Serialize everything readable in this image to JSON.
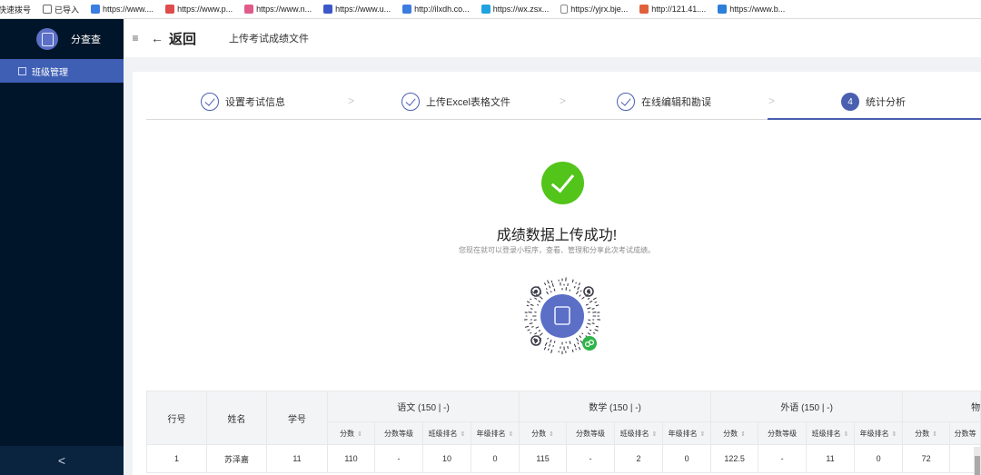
{
  "bookmarks": [
    {
      "label": "快速拨号",
      "icon": "",
      "color": ""
    },
    {
      "label": "已导入",
      "icon": "folder-icon",
      "color": "#666666"
    },
    {
      "label": "https://www....",
      "icon": "site-icon",
      "color": "#3b7de0"
    },
    {
      "label": "https://www.p...",
      "icon": "site-icon",
      "color": "#e04b4b"
    },
    {
      "label": "https://www.n...",
      "icon": "site-icon",
      "color": "#e05a8a"
    },
    {
      "label": "https://www.u...",
      "icon": "site-icon",
      "color": "#3b57c9"
    },
    {
      "label": "http://ilxdh.co...",
      "icon": "site-icon",
      "color": "#3b7de0"
    },
    {
      "label": "https://wx.zsx...",
      "icon": "site-icon",
      "color": "#1fa2e0"
    },
    {
      "label": "https://yjrx.bje...",
      "icon": "page-icon",
      "color": "#8a8a8a"
    },
    {
      "label": "http://121.41....",
      "icon": "site-icon",
      "color": "#e0603b"
    },
    {
      "label": "https://www.b...",
      "icon": "site-icon",
      "color": "#2b7fd8"
    }
  ],
  "sidebar": {
    "app_name": "分查查",
    "items": [
      {
        "label": "班级管理"
      }
    ],
    "collapse": "<"
  },
  "topbar": {
    "menu_icon": "≡",
    "back_arrow": "←",
    "back_label": "返回",
    "page_title": "上传考试成绩文件"
  },
  "steps": [
    {
      "label": "设置考试信息",
      "status": "done"
    },
    {
      "label": "上传Excel表格文件",
      "status": "done"
    },
    {
      "label": "在线编辑和勘误",
      "status": "done"
    },
    {
      "label": "统计分析",
      "status": "active",
      "number": "4"
    }
  ],
  "step_separator": ">",
  "result": {
    "title": "成绩数据上传成功!",
    "subtitle": "您现在就可以登录小程序，查看、管理和分享此次考试成绩。"
  },
  "table": {
    "fixed_headers": [
      "行号",
      "姓名",
      "学号"
    ],
    "subjects": [
      {
        "name": "语文 (150 | -)"
      },
      {
        "name": "数学 (150 | -)"
      },
      {
        "name": "外语 (150 | -)"
      },
      {
        "name": "物"
      }
    ],
    "sub_headers": [
      "分数",
      "分数等级",
      "班级排名",
      "年级排名"
    ],
    "last_sub_headers": [
      "分数",
      "分数等"
    ],
    "rows": [
      [
        "1",
        "苏泽嘉",
        "11",
        "110",
        "-",
        "10",
        "0",
        "115",
        "-",
        "2",
        "0",
        "122.5",
        "-",
        "11",
        "0",
        "72",
        ""
      ]
    ]
  },
  "colors": {
    "sidebar_bg": "#001529",
    "accent": "#4a5fb0",
    "success": "#52c41a"
  }
}
